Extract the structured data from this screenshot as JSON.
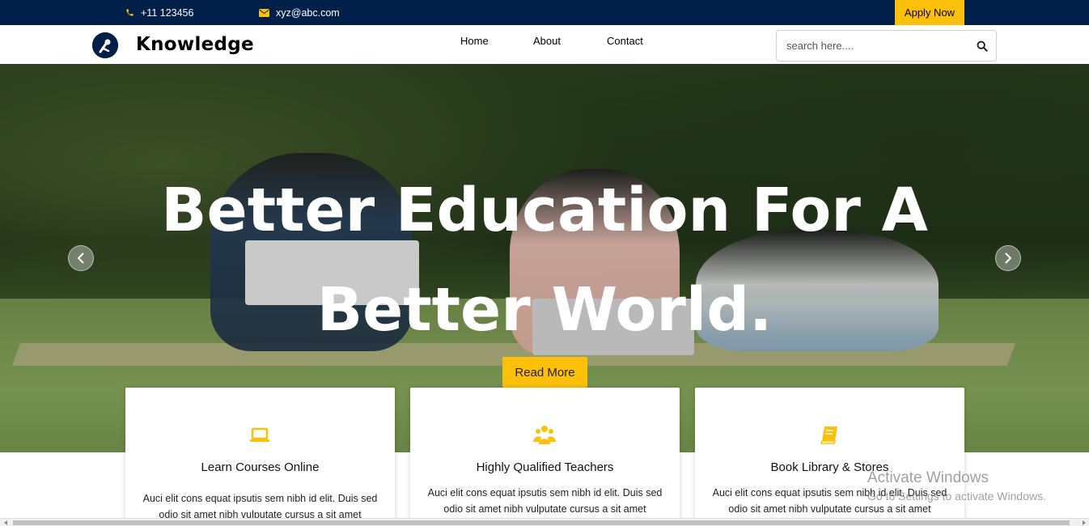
{
  "topbar": {
    "phone": "+11 123456",
    "email": "xyz@abc.com",
    "apply_label": "Apply Now"
  },
  "navbar": {
    "brand": "Knowledge",
    "links": [
      "Home",
      "About",
      "Contact"
    ],
    "search_placeholder": "search here...."
  },
  "hero": {
    "title_line1": "Better Education For A",
    "title_line2": "Better World.",
    "button_label": "Read More"
  },
  "features": [
    {
      "icon": "laptop-icon",
      "title": "Learn Courses Online",
      "text": "Auci elit cons equat ipsutis sem nibh id elit. Duis sed odio sit amet nibh vulputate cursus a sit amet"
    },
    {
      "icon": "users-icon",
      "title": "Highly Qualified Teachers",
      "text": "Auci elit cons equat ipsutis sem nibh id elit. Duis sed odio sit amet nibh vulputate cursus a sit amet"
    },
    {
      "icon": "book-icon",
      "title": "Book Library & Stores",
      "text": "Auci elit cons equat ipsutis sem nibh id elit. Duis sed odio sit amet nibh vulputate cursus a sit amet"
    }
  ],
  "watermark": {
    "line1": "Activate Windows",
    "line2": "Go to Settings to activate Windows."
  },
  "colors": {
    "navy": "#00204a",
    "accent": "#fdc00a"
  }
}
